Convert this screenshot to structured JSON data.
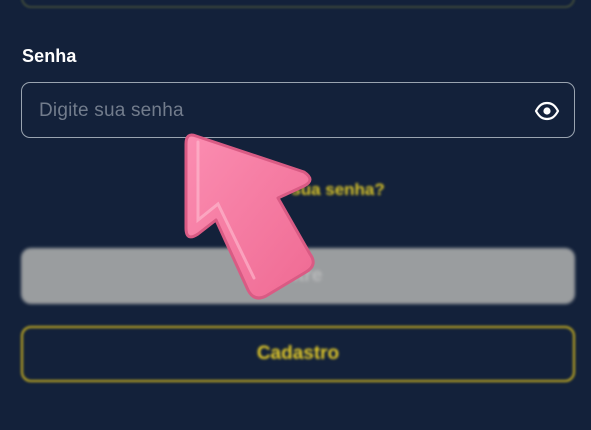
{
  "colors": {
    "background": "#13213a",
    "accent": "#d9c42a",
    "input_border": "#9aa4b0",
    "disabled_button": "#9a9d9f",
    "pointer": "#f5789e"
  },
  "password_field": {
    "label": "Senha",
    "placeholder": "Digite sua senha",
    "value": "",
    "toggle_icon": "eye-icon"
  },
  "forgot_password": {
    "label": "Esqueceu sua senha?"
  },
  "actions": {
    "login_label": "Entre",
    "login_disabled": true,
    "signup_label": "Cadastro"
  },
  "overlay": {
    "icon": "arrow-pointer-icon"
  }
}
